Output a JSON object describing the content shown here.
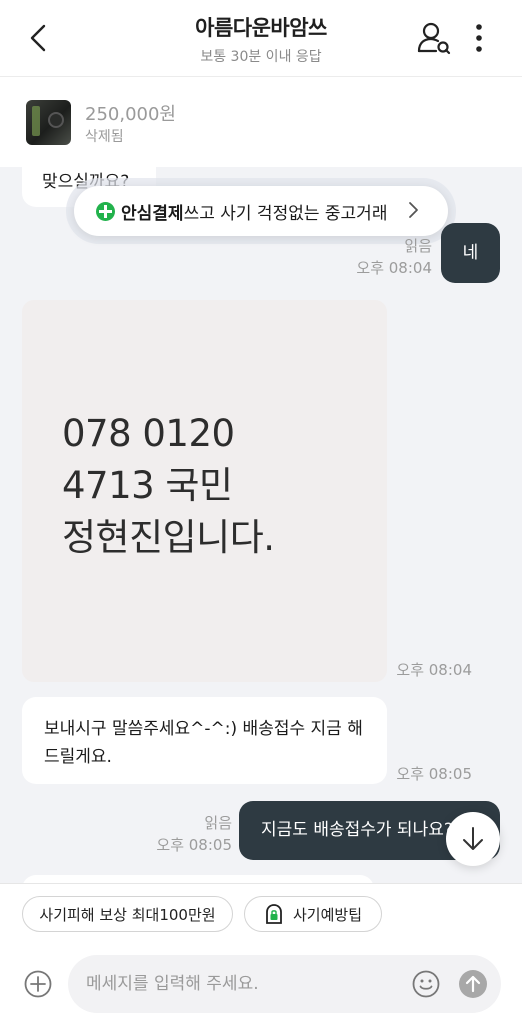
{
  "header": {
    "title": "아름다운바암쓰",
    "subtitle": "보통 30분 이내 응답",
    "back_icon": "chevron-left-icon",
    "profile_icon": "user-search-icon",
    "more_icon": "more-vertical-icon"
  },
  "product": {
    "price": "250,000원",
    "status": "삭제됨"
  },
  "safe_payment": {
    "bold": "안심결제",
    "text": "쓰고 사기 걱정없는 중고거래",
    "icon": "plus-shield-icon",
    "accent": "#22b24c"
  },
  "messages": [
    {
      "side": "in",
      "text": "맞으실까요?"
    },
    {
      "side": "out",
      "text": "네",
      "read": "읽음",
      "time": "오후 08:04"
    },
    {
      "side": "in",
      "type": "image",
      "lines": [
        "078 0120",
        "4713 국민",
        "정현진입니다."
      ],
      "time": "오후 08:04"
    },
    {
      "side": "in",
      "text": "보내시구 말씀주세요^-^:) 배송접수 지금 해드릴게요.",
      "time": "오후 08:05"
    },
    {
      "side": "out",
      "text": "지금도 배송접수가 되나요?",
      "read": "읽음",
      "time": "오후 08:05"
    }
  ],
  "chips": {
    "compensation": "사기피해 보상 최대100만원",
    "prevention": "사기예방팁"
  },
  "composer": {
    "placeholder": "메세지를 입력해 주세요."
  },
  "colors": {
    "outgoing_bubble": "#2e3a42",
    "incoming_bubble": "#ffffff",
    "chat_background": "#f2f3f6"
  }
}
